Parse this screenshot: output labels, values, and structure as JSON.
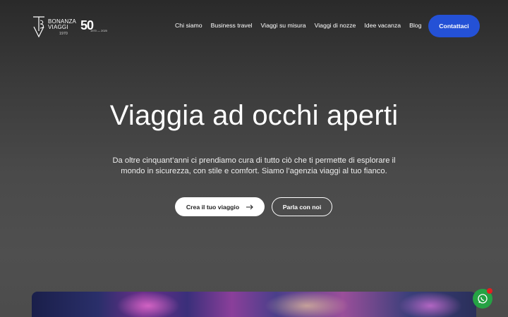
{
  "header": {
    "logo": {
      "brand_line1": "BONANZA",
      "brand_line2": "VIAGGI",
      "founded": "1970",
      "anniversary_number": "50",
      "anniversary_sub": "1970 — 2020"
    },
    "nav": [
      {
        "label": "Chi siamo"
      },
      {
        "label": "Business travel"
      },
      {
        "label": "Viaggi su misura"
      },
      {
        "label": "Viaggi di nozze"
      },
      {
        "label": "Idee vacanza"
      },
      {
        "label": "Blog"
      }
    ],
    "contact_label": "Contattaci"
  },
  "hero": {
    "title": "Viaggia ad occhi aperti",
    "subtitle": "Da oltre cinquant’anni ci prendiamo cura di tutto ciò che ti permette di esplorare il mondo in sicurezza, con stile e comfort. Siamo l’agenzia viaggi al tuo fianco.",
    "primary_cta": "Crea il tuo viaggio",
    "secondary_cta": "Parla con noi"
  },
  "icons": {
    "arrow": "arrow-right-icon",
    "whatsapp": "whatsapp-icon"
  },
  "colors": {
    "accent": "#2451d6",
    "whatsapp": "#25a244",
    "notification": "#e02020"
  }
}
